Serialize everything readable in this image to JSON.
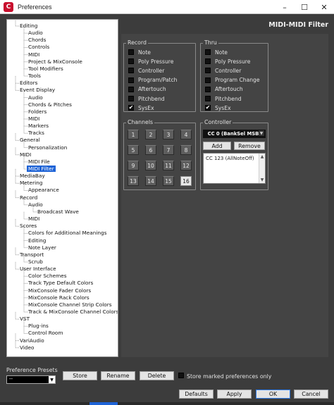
{
  "window": {
    "title": "Preferences",
    "app_icon_glyph": "C",
    "controls": [
      "–",
      "☐",
      "✕"
    ]
  },
  "tree": {
    "items": [
      {
        "label": "Editing",
        "level": 1
      },
      {
        "label": "Audio",
        "level": 2
      },
      {
        "label": "Chords",
        "level": 2
      },
      {
        "label": "Controls",
        "level": 2
      },
      {
        "label": "MIDI",
        "level": 2
      },
      {
        "label": "Project & MixConsole",
        "level": 2
      },
      {
        "label": "Tool Modifiers",
        "level": 2
      },
      {
        "label": "Tools",
        "level": 2
      },
      {
        "label": "Editors",
        "level": 1
      },
      {
        "label": "Event Display",
        "level": 1
      },
      {
        "label": "Audio",
        "level": 2
      },
      {
        "label": "Chords & Pitches",
        "level": 2
      },
      {
        "label": "Folders",
        "level": 2
      },
      {
        "label": "MIDI",
        "level": 2
      },
      {
        "label": "Markers",
        "level": 2
      },
      {
        "label": "Tracks",
        "level": 2
      },
      {
        "label": "General",
        "level": 1
      },
      {
        "label": "Personalization",
        "level": 2
      },
      {
        "label": "MIDI",
        "level": 1
      },
      {
        "label": "MIDI File",
        "level": 2
      },
      {
        "label": "MIDI Filter",
        "level": 2,
        "selected": true
      },
      {
        "label": "MediaBay",
        "level": 1
      },
      {
        "label": "Metering",
        "level": 1
      },
      {
        "label": "Appearance",
        "level": 2
      },
      {
        "label": "Record",
        "level": 1
      },
      {
        "label": "Audio",
        "level": 2
      },
      {
        "label": "Broadcast Wave",
        "level": 3
      },
      {
        "label": "MIDI",
        "level": 2
      },
      {
        "label": "Scores",
        "level": 1
      },
      {
        "label": "Colors for Additional Meanings",
        "level": 2
      },
      {
        "label": "Editing",
        "level": 2
      },
      {
        "label": "Note Layer",
        "level": 2
      },
      {
        "label": "Transport",
        "level": 1
      },
      {
        "label": "Scrub",
        "level": 2
      },
      {
        "label": "User Interface",
        "level": 1
      },
      {
        "label": "Color Schemes",
        "level": 2
      },
      {
        "label": "Track Type Default Colors",
        "level": 2
      },
      {
        "label": "MixConsole Fader Colors",
        "level": 2
      },
      {
        "label": "MixConsole Rack Colors",
        "level": 2
      },
      {
        "label": "MixConsole Channel Strip Colors",
        "level": 2
      },
      {
        "label": "Track & MixConsole Channel Colors",
        "level": 2
      },
      {
        "label": "VST",
        "level": 1
      },
      {
        "label": "Plug-ins",
        "level": 2
      },
      {
        "label": "Control Room",
        "level": 2
      },
      {
        "label": "VariAudio",
        "level": 1
      },
      {
        "label": "Video",
        "level": 1
      }
    ]
  },
  "page": {
    "title": "MIDI-MIDI Filter"
  },
  "record": {
    "label": "Record",
    "items": [
      {
        "label": "Note",
        "checked": false
      },
      {
        "label": "Poly Pressure",
        "checked": false
      },
      {
        "label": "Controller",
        "checked": false
      },
      {
        "label": "Program/Patch",
        "checked": false
      },
      {
        "label": "Aftertouch",
        "checked": false
      },
      {
        "label": "Pitchbend",
        "checked": false
      },
      {
        "label": "SysEx",
        "checked": true
      }
    ]
  },
  "thru": {
    "label": "Thru",
    "items": [
      {
        "label": "Note",
        "checked": false
      },
      {
        "label": "Poly Pressure",
        "checked": false
      },
      {
        "label": "Controller",
        "checked": false
      },
      {
        "label": "Program Change",
        "checked": false
      },
      {
        "label": "Aftertouch",
        "checked": false
      },
      {
        "label": "Pitchbend",
        "checked": false
      },
      {
        "label": "SysEx",
        "checked": true
      }
    ]
  },
  "channels": {
    "label": "Channels",
    "buttons": [
      "1",
      "2",
      "3",
      "4",
      "5",
      "6",
      "7",
      "8",
      "9",
      "10",
      "11",
      "12",
      "13",
      "14",
      "15",
      "16"
    ],
    "active": [
      "16"
    ]
  },
  "controller": {
    "label": "Controller",
    "selected": "CC 0  (BankSel MSB)",
    "add_label": "Add",
    "remove_label": "Remove",
    "list": [
      "CC 123  (AllNoteOff)"
    ]
  },
  "presets": {
    "label": "Preference Presets",
    "selected": "--",
    "store_label": "Store",
    "rename_label": "Rename",
    "delete_label": "Delete",
    "store_marked_label": "Store marked preferences only"
  },
  "footer": {
    "defaults_label": "Defaults",
    "apply_label": "Apply",
    "ok_label": "OK",
    "cancel_label": "Cancel"
  },
  "icons": {
    "check": "✔",
    "down": "▼",
    "up": "▲"
  },
  "colors": {
    "selection": "#1e63d6",
    "background": "#3c3c3c",
    "panel": "#444444"
  }
}
